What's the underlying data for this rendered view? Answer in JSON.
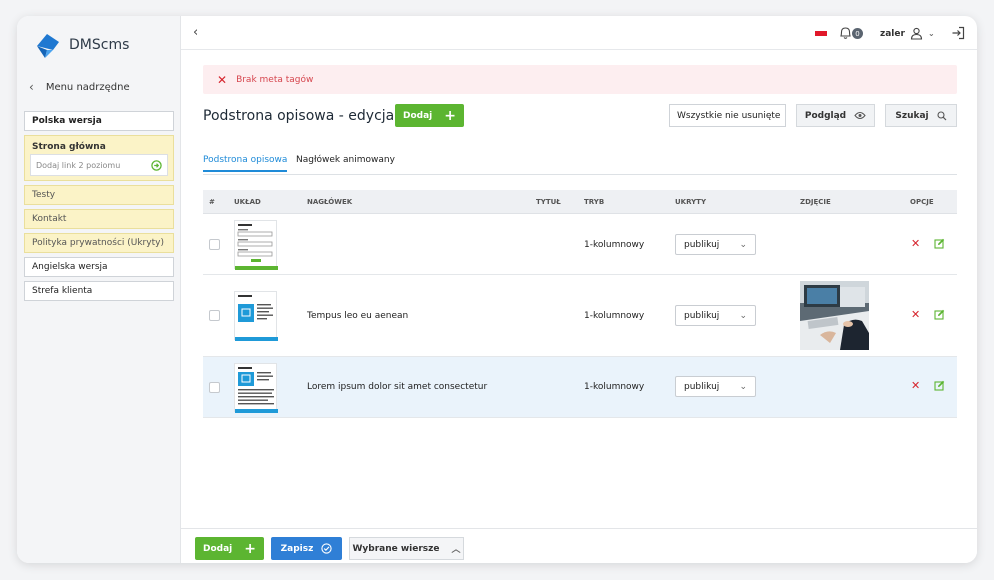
{
  "app": {
    "name": "DMScms"
  },
  "sidebar": {
    "back_label": "Menu nadrzędne",
    "items": [
      {
        "label": "Polska wersja",
        "style": "bold"
      },
      {
        "label": "Strona główna",
        "style": "group"
      },
      {
        "label": "Testy",
        "style": "yellow"
      },
      {
        "label": "Kontakt",
        "style": "yellow"
      },
      {
        "label": "Polityka prywatności (Ukryty)",
        "style": "yellow"
      },
      {
        "label": "Angielska wersja",
        "style": "plain"
      },
      {
        "label": "Strefa klienta",
        "style": "plain"
      }
    ],
    "add_link_placeholder": "Dodaj link 2 poziomu"
  },
  "topbar": {
    "notifications_count": "0",
    "username": "zaler"
  },
  "alert": {
    "text": "Brak meta tagów"
  },
  "page": {
    "title": "Podstrona opisowa - edycja (3)",
    "add_label": "Dodaj",
    "filter_value": "Wszystkie nie usunięte",
    "preview_label": "Podgląd",
    "search_label": "Szukaj"
  },
  "tabs": [
    {
      "label": "Podstrona opisowa",
      "active": true
    },
    {
      "label": "Nagłówek animowany",
      "active": false
    }
  ],
  "table": {
    "columns": [
      "#",
      "UKŁAD",
      "NAGŁÓWEK",
      "TYTUŁ",
      "TRYB",
      "UKRYTY",
      "ZDJĘCIE",
      "OPCJE"
    ],
    "rows": [
      {
        "heading": "",
        "title": "",
        "mode": "1-kolumnowy",
        "hidden": "publikuj",
        "has_photo": false
      },
      {
        "heading": "Tempus leo eu aenean",
        "title": "",
        "mode": "1-kolumnowy",
        "hidden": "publikuj",
        "has_photo": true
      },
      {
        "heading": "Lorem ipsum dolor sit amet consectetur",
        "title": "",
        "mode": "1-kolumnowy",
        "hidden": "publikuj",
        "has_photo": false
      }
    ]
  },
  "footer": {
    "add_label": "Dodaj",
    "save_label": "Zapisz",
    "selected_rows_label": "Wybrane wiersze"
  },
  "colors": {
    "green": "#5cb531",
    "blue": "#2f7fd6",
    "red": "#d6242d",
    "accent_tab": "#1f8bd8"
  }
}
